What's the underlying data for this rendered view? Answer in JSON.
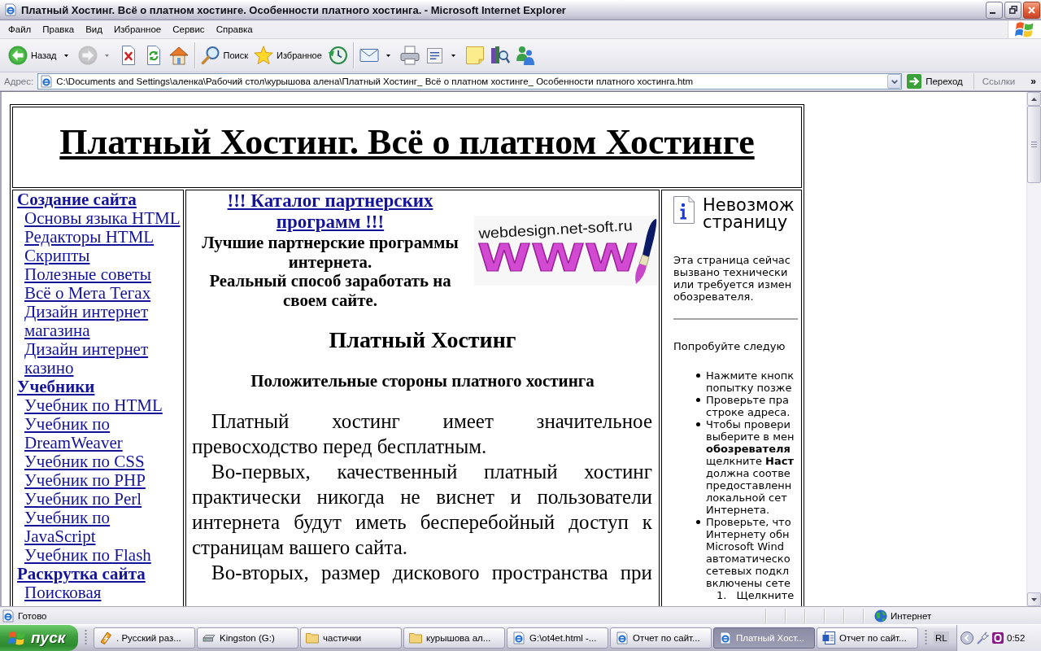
{
  "window": {
    "title": "Платный Хостинг. Всё о платном хостинге. Особенности платного хостинга. - Microsoft Internet Explorer"
  },
  "menu": [
    "Файл",
    "Правка",
    "Вид",
    "Избранное",
    "Сервис",
    "Справка"
  ],
  "toolbar": {
    "groups": [
      {
        "buttons": [
          {
            "kind": "back",
            "label": "Назад",
            "dropdown": true,
            "disabled": false
          },
          {
            "kind": "forward",
            "dropdown": true,
            "disabled": true
          },
          {
            "kind": "stop",
            "dropdown": false,
            "disabled": false
          },
          {
            "kind": "refresh",
            "dropdown": false,
            "disabled": false
          },
          {
            "kind": "home",
            "dropdown": false,
            "disabled": false
          }
        ]
      },
      {
        "buttons": [
          {
            "kind": "search",
            "label": "Поиск",
            "dropdown": false,
            "disabled": false
          },
          {
            "kind": "favorites",
            "label": "Избранное",
            "dropdown": false,
            "disabled": false
          },
          {
            "kind": "history",
            "dropdown": false,
            "disabled": false
          }
        ]
      },
      {
        "buttons": [
          {
            "kind": "mail",
            "dropdown": true,
            "disabled": false
          },
          {
            "kind": "print",
            "dropdown": false,
            "disabled": false
          },
          {
            "kind": "edit",
            "dropdown": true,
            "disabled": false
          },
          {
            "kind": "note",
            "dropdown": false,
            "disabled": false
          },
          {
            "kind": "research",
            "dropdown": false,
            "disabled": false
          },
          {
            "kind": "messenger",
            "dropdown": false,
            "disabled": false
          }
        ]
      }
    ]
  },
  "address_bar": {
    "label": "Адрес:",
    "value": "C:\\Documents and Settings\\аленка\\Рабочий стол\\курышова алена\\Платный Хостинг_ Всё о платном хостинге_ Особенности платного хостинга.htm",
    "go_label": "Переход",
    "links_label": "Ссылки",
    "more": "»"
  },
  "page": {
    "site_title": "Платный Хостинг. Всё о платном Хостинге",
    "sidebar": {
      "sections": [
        {
          "title": "Создание сайта",
          "links": [
            "Основы языка HTML",
            "Редакторы HTML",
            "Скрипты",
            "Полезные советы",
            "Всё о Мета Тегах",
            "Дизайн интернет магазина",
            "Дизайн интернет казино"
          ]
        },
        {
          "title": "Учебники",
          "links": [
            "Учебник по HTML",
            "Учебник по DreamWeaver",
            "Учебник по CSS",
            "Учебник по PHP",
            "Учебник по Perl",
            "Учебник по JavaScript",
            "Учебник по Flash"
          ]
        },
        {
          "title": "Раскрутка сайта",
          "links": [
            "Поисковая"
          ]
        }
      ]
    },
    "main": {
      "promo_link": "!!! Каталог партнерских программ !!!",
      "promo_lines": [
        "Лучшие партнерские программы интернета.",
        "Реальный способ заработать на своем сайте."
      ],
      "banner": {
        "caption": "webdesign.net-soft.ru",
        "letters": "WWW"
      },
      "heading": "Платный Хостинг",
      "subheading": "Положительные стороны платного хостинга",
      "paragraphs": [
        "Платный хостинг имеет значительное превосходство перед бесплатным.",
        "Во-первых, качественный платный хостинг практически никогда не виснет и пользователи интернета будут иметь бесперебойный доступ к страницам вашего сайта.",
        "Во-вторых, размер дискового пространства при"
      ]
    },
    "error_frame": {
      "heading": "Невозмож\nстраницу",
      "intro": "Эта страница сейчас\nвызвано технически\nили требуется измен\nобозревателя.",
      "prompt": "Попробуйте следую",
      "bullets": [
        "Нажмите кнопк\nпопытку позже",
        "Проверьте пра\nстроке адреса.",
        "Чтобы провери\nвыберите в мен\n**обозревателя**\nщелкните **Наст**\nдолжна соотве\nпредоставленн\nлокальной сет\nИнтернета.",
        "Проверьте, что\nИнтернету обн\nMicrosoft Wind\nавтоматическо\nсетевых подкл\nвключены сете"
      ],
      "steps": [
        {
          "number": "1.",
          "text": "Щелкните"
        }
      ]
    }
  },
  "status_bar": {
    "text": "Готово",
    "zone": "Интернет"
  },
  "taskbar": {
    "start": "пуск",
    "tasks": [
      {
        "kind": "player",
        "label": ". Русский раз...",
        "selected": false
      },
      {
        "kind": "drive",
        "label": "Kingston (G:)",
        "selected": false
      },
      {
        "kind": "folder",
        "label": "частички",
        "selected": false
      },
      {
        "kind": "folder",
        "label": "курышова ал...",
        "selected": false
      },
      {
        "kind": "browser",
        "label": "G:\\ot4et.html -...",
        "selected": false
      },
      {
        "kind": "browser",
        "label": "Отчет по сайт...",
        "selected": false
      },
      {
        "kind": "browser",
        "label": "Платный Хост...",
        "selected": true
      },
      {
        "kind": "word",
        "label": "Отчет по сайт...",
        "selected": false
      }
    ],
    "language": "RL",
    "clock": "0:52"
  }
}
